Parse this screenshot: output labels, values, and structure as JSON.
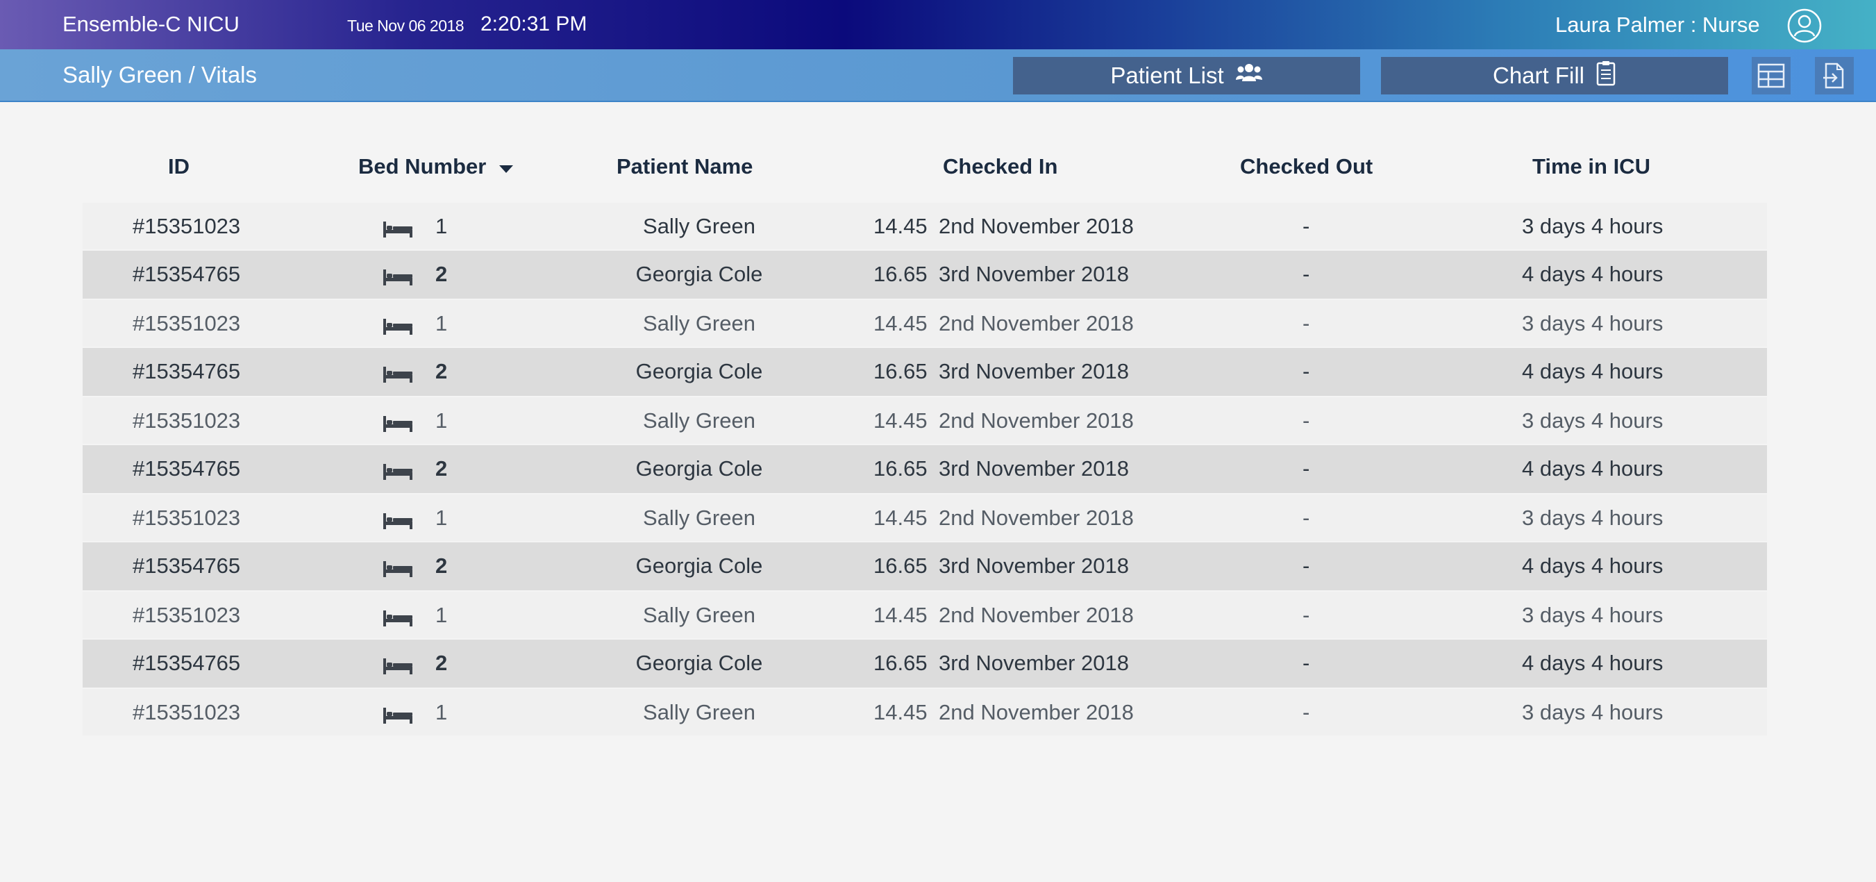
{
  "header": {
    "app_title": "Ensemble-C NICU",
    "date": "Tue Nov 06 2018",
    "time": "2:20:31 PM",
    "user": "Laura Palmer : Nurse",
    "avatar_icon": "user-circle-icon"
  },
  "subheader": {
    "breadcrumb": "Sally Green / Vitals",
    "patient_list_label": "Patient List",
    "patient_list_icon": "users-icon",
    "chart_fill_label": "Chart Fill",
    "chart_fill_icon": "clipboard-icon",
    "grid_icon": "table-layout-icon",
    "export_icon": "export-document-icon"
  },
  "table": {
    "columns": [
      "ID",
      "Bed Number",
      "Patient Name",
      "Checked In",
      "Checked Out",
      "Time in ICU"
    ],
    "sort_icon": "sort-down-icon",
    "rows": [
      {
        "id": "#15351023",
        "bed": "1",
        "name": "Sally Green",
        "time": "14.45",
        "date": "2nd November 2018",
        "out": "-",
        "icu": "3 days 4 hours"
      },
      {
        "id": "#15354765",
        "bed": "2",
        "name": "Georgia Cole",
        "time": "16.65",
        "date": "3rd November 2018",
        "out": "-",
        "icu": "4 days 4 hours"
      },
      {
        "id": "#15351023",
        "bed": "1",
        "name": "Sally Green",
        "time": "14.45",
        "date": "2nd November 2018",
        "out": "-",
        "icu": "3 days 4 hours"
      },
      {
        "id": "#15354765",
        "bed": "2",
        "name": "Georgia Cole",
        "time": "16.65",
        "date": "3rd November 2018",
        "out": "-",
        "icu": "4 days 4 hours"
      },
      {
        "id": "#15351023",
        "bed": "1",
        "name": "Sally Green",
        "time": "14.45",
        "date": "2nd November 2018",
        "out": "-",
        "icu": "3 days 4 hours"
      },
      {
        "id": "#15354765",
        "bed": "2",
        "name": "Georgia Cole",
        "time": "16.65",
        "date": "3rd November 2018",
        "out": "-",
        "icu": "4 days 4 hours"
      },
      {
        "id": "#15351023",
        "bed": "1",
        "name": "Sally Green",
        "time": "14.45",
        "date": "2nd November 2018",
        "out": "-",
        "icu": "3 days 4 hours"
      },
      {
        "id": "#15354765",
        "bed": "2",
        "name": "Georgia Cole",
        "time": "16.65",
        "date": "3rd November 2018",
        "out": "-",
        "icu": "4 days 4 hours"
      },
      {
        "id": "#15351023",
        "bed": "1",
        "name": "Sally Green",
        "time": "14.45",
        "date": "2nd November 2018",
        "out": "-",
        "icu": "3 days 4 hours"
      },
      {
        "id": "#15354765",
        "bed": "2",
        "name": "Georgia Cole",
        "time": "16.65",
        "date": "3rd November 2018",
        "out": "-",
        "icu": "4 days 4 hours"
      },
      {
        "id": "#15351023",
        "bed": "1",
        "name": "Sally Green",
        "time": "14.45",
        "date": "2nd November 2018",
        "out": "-",
        "icu": "3 days 4 hours"
      }
    ]
  }
}
